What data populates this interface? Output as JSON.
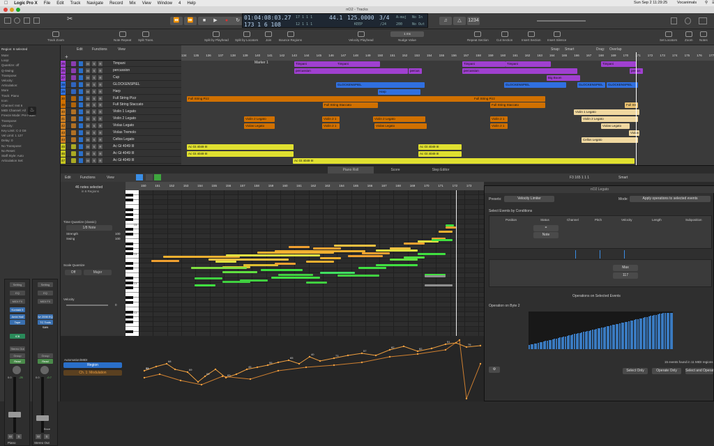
{
  "menubar": {
    "items": [
      "Logic Pro X",
      "File",
      "Edit",
      "Track",
      "Navigate",
      "Record",
      "Mix",
      "View",
      "Window",
      "4",
      "Help"
    ],
    "clock": "Sun Sep 2  11:29:25",
    "user": "Vocanimals"
  },
  "window": {
    "title": "nO2 - Tracks"
  },
  "lcd": {
    "time": "01:04:08:03.27",
    "bars": "173  1  6  108",
    "bar_top": "17  1  1  1",
    "bar_bottom": "12  1  1  1",
    "sample_rate": "44.1",
    "tempo": "125.0000",
    "tempo_label": "KEEP",
    "signature": "3/4",
    "division": "/24",
    "key": "A♭maj",
    "value": "200",
    "input": "No In",
    "output": "No Out"
  },
  "toolbar": {
    "items": [
      "Track Zoom",
      "Note Repeat",
      "Split Trans.",
      "Split by Playhead",
      "Split by Locators",
      "Join",
      "Bounce Regions",
      "Velocity Playhead",
      "Nudge Value",
      "Repeat Section",
      "Cut Section",
      "Insert Section",
      "Insert Silence",
      "Set Locators",
      "Zoom",
      "Notes"
    ],
    "nudge_value": "1 ms"
  },
  "inspector": {
    "region": "Region: 6 selected",
    "rows": [
      "Mute:",
      "Loop:",
      "Quantize:  off",
      "Q-Swing:",
      "Transpose:",
      "Velocity:",
      "Articulation:",
      "More",
      "Track:  Piano",
      "Icon:",
      "Channel:  Inst 6",
      "MIDI Channel:  All",
      "Freeze Mode:  Pre Fader",
      "Transpose:",
      "Velocity:",
      "Key Limit:  C-2  G8",
      "Vel Limit:  1  127",
      "Delay:  0",
      "No Transpose:",
      "No Reset:",
      "Staff Style:  Auto",
      "Articulation Set:"
    ],
    "strip1": {
      "setting": "Setting",
      "eq": "EQ",
      "midi_fx": "MIDI FX",
      "instrument": "Kontakt 5",
      "fx1": "Ambi Hall",
      "fx2": "Tape",
      "send": "ICB",
      "output": "Stereo Out",
      "group": "Group",
      "mode": "Read",
      "volume": "0.0",
      "pan": "-25",
      "name": "Piano"
    },
    "strip2": {
      "setting": "Setting",
      "eq": "EQ",
      "midi_fx": "MIDI FX",
      "instrument": "Ivr 2098 EQ",
      "fx1": "TC Tools SAN",
      "fx2": "",
      "send": "",
      "output": "",
      "group": "Group",
      "mode": "Read",
      "volume": "0.0",
      "pan": "-0.7",
      "name": "Stereo Out",
      "bounce": "Bnce"
    }
  },
  "tracks_header": {
    "edit": "Edit",
    "functions": "Functions",
    "view": "View"
  },
  "tracks": [
    {
      "num": "25",
      "name": "Timpani",
      "color": "#a040d0"
    },
    {
      "num": "26",
      "name": "percussion",
      "color": "#a040d0"
    },
    {
      "num": "27",
      "name": "Cup",
      "color": "#a040d0"
    },
    {
      "num": "28",
      "name": "GLOCKENSPIEL",
      "color": "#3070e0"
    },
    {
      "num": "29",
      "name": "Harp",
      "color": "#3070e0"
    },
    {
      "num": "30",
      "name": "Full String Pizz",
      "color": "#d07000"
    },
    {
      "num": "39",
      "name": "Full String Staccato",
      "color": "#d07000"
    },
    {
      "num": "40",
      "name": "Violin 1 Legato",
      "color": "#d08020"
    },
    {
      "num": "41",
      "name": "Violin 2 Legato",
      "color": "#d08020"
    },
    {
      "num": "42",
      "name": "Violas Legato",
      "color": "#d08020"
    },
    {
      "num": "43",
      "name": "Violas Tremolo",
      "color": "#d08020"
    },
    {
      "num": "44",
      "name": "Cellos Legato",
      "color": "#d08020"
    },
    {
      "num": "45",
      "name": "Ac Gt 4049 III",
      "color": "#c8c820"
    },
    {
      "num": "46",
      "name": "Ac Gt 4049 III",
      "color": "#c8c820"
    },
    {
      "num": "47",
      "name": "Ac Gt 4049 III",
      "color": "#c8c820"
    }
  ],
  "arrange": {
    "snap_label": "Snap:",
    "snap": "Smart",
    "drag_label": "Drag:",
    "drag": "Overlap",
    "marker": "Marker 1",
    "ruler": [
      "134",
      "135",
      "136",
      "137",
      "138",
      "139",
      "140",
      "141",
      "142",
      "143",
      "144",
      "145",
      "146",
      "147",
      "148",
      "149",
      "150",
      "151",
      "152",
      "153",
      "154",
      "155",
      "156",
      "157",
      "158",
      "159",
      "160",
      "161",
      "162",
      "163",
      "164",
      "165",
      "166",
      "167",
      "168",
      "169",
      "170",
      "171",
      "172",
      "173",
      "174",
      "175",
      "176",
      "177"
    ],
    "regions": [
      {
        "label": "Timpani",
        "track": 0,
        "start": 162,
        "end": 260,
        "color": "#a040d0"
      },
      {
        "label": "Timpani",
        "track": 0,
        "start": 222,
        "end": 285,
        "color": "#a040d0"
      },
      {
        "label": "Timpani",
        "track": 0,
        "start": 403,
        "end": 465,
        "color": "#a040d0"
      },
      {
        "label": "Timpani",
        "track": 0,
        "start": 465,
        "end": 530,
        "color": "#a040d0"
      },
      {
        "label": "Timpani",
        "track": 0,
        "start": 602,
        "end": 652,
        "color": "#a040d0"
      },
      {
        "label": "percussion",
        "track": 1,
        "start": 162,
        "end": 325,
        "color": "#a040d0"
      },
      {
        "label": "percus",
        "track": 1,
        "start": 326,
        "end": 345,
        "color": "#a040d0"
      },
      {
        "label": "percussion",
        "track": 1,
        "start": 403,
        "end": 568,
        "color": "#a040d0"
      },
      {
        "label": "percus",
        "track": 1,
        "start": 643,
        "end": 662,
        "color": "#a040d0"
      },
      {
        "label": "Big Boom",
        "track": 2,
        "start": 524,
        "end": 572,
        "color": "#a040d0"
      },
      {
        "label": "GLOCKENSPIEL",
        "track": 3,
        "start": 222,
        "end": 349,
        "color": "#3070e0"
      },
      {
        "label": "GLOCKENSPIEL",
        "track": 3,
        "start": 463,
        "end": 552,
        "color": "#3070e0"
      },
      {
        "label": "GLOCKENSPIEL",
        "track": 3,
        "start": 568,
        "end": 608,
        "color": "#3070e0"
      },
      {
        "label": "GLOCKENSPIEL",
        "track": 3,
        "start": 610,
        "end": 655,
        "color": "#3070e0"
      },
      {
        "label": "Harp",
        "track": 4,
        "start": 282,
        "end": 343,
        "color": "#3070e0"
      },
      {
        "label": "Full String Pizz",
        "track": 5,
        "start": 8,
        "end": 460,
        "color": "#d07000"
      },
      {
        "label": "Full String Pizz",
        "track": 5,
        "start": 418,
        "end": 522,
        "color": "#d07000"
      },
      {
        "label": "Full String Staccato",
        "track": 6,
        "start": 203,
        "end": 282,
        "color": "#d07000"
      },
      {
        "label": "Full String Staccato",
        "track": 6,
        "start": 443,
        "end": 522,
        "color": "#d07000"
      },
      {
        "label": "Full Str",
        "track": 6,
        "start": 636,
        "end": 655,
        "color": "#e8c070"
      },
      {
        "label": "Violin 1 Legato",
        "track": 7,
        "start": 563,
        "end": 657,
        "color": "#f0d8a0"
      },
      {
        "label": "Violin 2 Legato",
        "track": 8,
        "start": 90,
        "end": 134,
        "color": "#d07000"
      },
      {
        "label": "Violin 2 1",
        "track": 8,
        "start": 202,
        "end": 227,
        "color": "#d07000"
      },
      {
        "label": "Violin 2 Legato",
        "track": 8,
        "start": 275,
        "end": 350,
        "color": "#d07000"
      },
      {
        "label": "Violin 2 1",
        "track": 8,
        "start": 443,
        "end": 468,
        "color": "#d07000"
      },
      {
        "label": "Violin 2 Legato",
        "track": 8,
        "start": 574,
        "end": 655,
        "color": "#f0d8a0"
      },
      {
        "label": "Violas Legato",
        "track": 9,
        "start": 90,
        "end": 134,
        "color": "#d07000"
      },
      {
        "label": "Violin 2 1",
        "track": 9,
        "start": 202,
        "end": 227,
        "color": "#d07000"
      },
      {
        "label": "Violas Legato",
        "track": 9,
        "start": 277,
        "end": 352,
        "color": "#d07000"
      },
      {
        "label": "Violin 2 1",
        "track": 9,
        "start": 443,
        "end": 468,
        "color": "#d07000"
      },
      {
        "label": "Violas Legato",
        "track": 9,
        "start": 602,
        "end": 643,
        "color": "#f0d8a0"
      },
      {
        "label": "Violas",
        "track": 10,
        "start": 642,
        "end": 657,
        "color": "#f0d8a0"
      },
      {
        "label": "Cellos Legato",
        "track": 11,
        "start": 574,
        "end": 655,
        "color": "#f0d8a0"
      },
      {
        "label": "Ac Gt 4049 III",
        "track": 12,
        "start": 8,
        "end": 161,
        "color": "#e0e030"
      },
      {
        "label": "Ac Gt 4049 III",
        "track": 12,
        "start": 340,
        "end": 402,
        "color": "#e0e030"
      },
      {
        "label": "Ac Gt 4049 III",
        "track": 13,
        "start": 8,
        "end": 161,
        "color": "#e0e030"
      },
      {
        "label": "Ac Gt 4049 III",
        "track": 13,
        "start": 340,
        "end": 402,
        "color": "#e0e030"
      },
      {
        "label": "Ac Gt 4049 III",
        "track": 14,
        "start": 160,
        "end": 650,
        "color": "#e0e030"
      }
    ]
  },
  "tabs": [
    "Piano Roll",
    "Score",
    "Step Editor"
  ],
  "editor": {
    "edit": "Edit",
    "functions": "Functions",
    "view": "View",
    "selection": "46 notes selected",
    "region_info": "in 6 Regions",
    "position": "F3  165 1 1 1",
    "snap": "Smart",
    "quantize_label": "Time Quantize (classic)",
    "quantize_value": "1/8 Note",
    "strength_label": "Strength",
    "strength": "100",
    "swing_label": "Swing",
    "swing": "100",
    "scale_label": "Scale Quantize",
    "scale_off": "Off",
    "scale_mode": "Major",
    "velocity_label": "Velocity",
    "velocity": "0",
    "automation_label": "Automation/MIDI",
    "region_btn": "Region",
    "cc_label": "Ch. 1: Modulation",
    "ruler": [
      "150",
      "151",
      "152",
      "153",
      "154",
      "155",
      "156",
      "157",
      "158",
      "159",
      "160",
      "161",
      "162",
      "163",
      "164",
      "165",
      "166",
      "167",
      "168",
      "169",
      "170",
      "171",
      "172",
      "173"
    ],
    "key_labels": [
      "C5",
      "C4",
      "C3",
      "C2",
      "C1"
    ],
    "auto_values": [
      "73",
      "68",
      "69",
      "65",
      "83",
      "45",
      "55",
      "65",
      "40",
      "73",
      "57",
      "82",
      "82",
      "51",
      "75",
      "64"
    ]
  },
  "transform": {
    "title": "nO2 Legato",
    "presets_label": "Presets:",
    "preset": "Velocity Limiter",
    "mode_label": "Mode:",
    "mode": "Apply operations to selected events",
    "conditions_title": "Select Events by Conditions",
    "columns": [
      "Position",
      "Status",
      "Channel",
      "Pitch",
      "Velocity",
      "Length",
      "Subposition"
    ],
    "status_op": "=",
    "status_val": "Note",
    "vel_op": "Max",
    "vel_val": "117",
    "operations_title": "Operations on Selected Events",
    "byte_label": "Operation on Byte 2",
    "found": "15 events found in 11 MIDI regions",
    "btn_select": "Select Only",
    "btn_operate": "Operate Only",
    "btn_both": "Select and Operate"
  },
  "colors": {
    "accent": "#3a8ee6",
    "record": "#e03030",
    "timpani": "#a040d0",
    "glock": "#3070e0",
    "strings": "#d07000",
    "guitar": "#e0e030"
  }
}
